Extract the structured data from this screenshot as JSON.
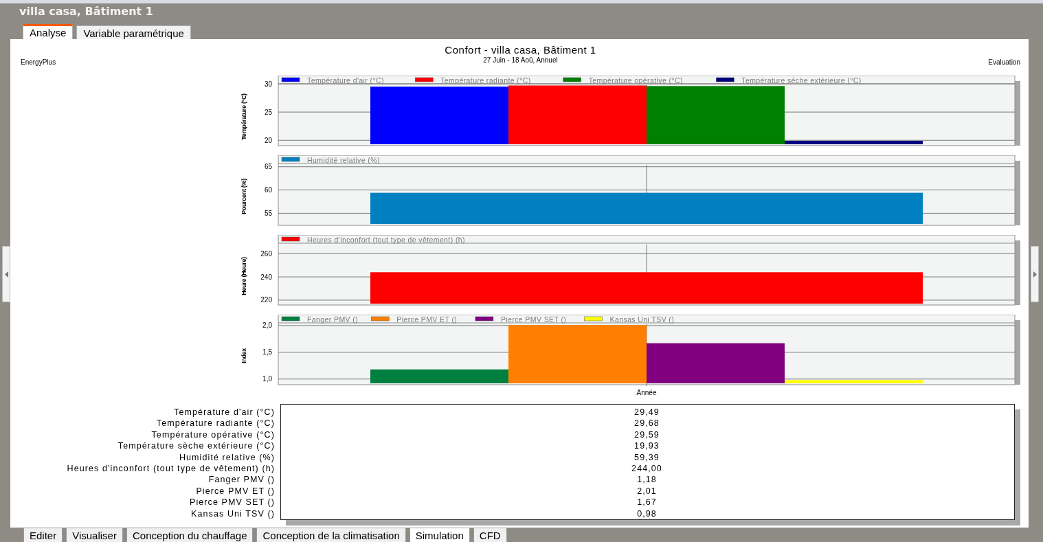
{
  "window": {
    "title": "villa casa, Bâtiment 1"
  },
  "tabs": [
    {
      "label": "Analyse",
      "selected": true
    },
    {
      "label": "Variable paramétrique",
      "selected": false
    }
  ],
  "report": {
    "source": "EnergyPlus",
    "title": "Confort - villa casa, Bâtiment 1",
    "subtitle": "27 Juin - 18 Aoû, Annuel",
    "mode": "Evaluation"
  },
  "charts": [
    {
      "chart_data": {
        "type": "bar",
        "grid": true,
        "legend": true,
        "ylabel": "Température (°C)",
        "ylim": [
          19.3,
          30
        ],
        "yticks": [
          {
            "value": 20,
            "label": "20"
          },
          {
            "value": 25,
            "label": "25"
          },
          {
            "value": 30,
            "label": "30"
          }
        ],
        "series": [
          {
            "name": "Température d'air (°C)",
            "color": "#0000ff",
            "values": [
              29.5
            ]
          },
          {
            "name": "Température radiante (°C)",
            "color": "#ff0000",
            "values": [
              29.7
            ]
          },
          {
            "name": "Température opérative (°C)",
            "color": "#008000",
            "values": [
              29.6
            ]
          },
          {
            "name": "Température sèche extérieure (°C)",
            "color": "#000080",
            "values": [
              19.9
            ]
          }
        ]
      }
    },
    {
      "chart_data": {
        "type": "bar",
        "grid": true,
        "legend": true,
        "ylabel": "Pourcent (%)",
        "ylim": [
          52.7,
          65.7
        ],
        "yticks": [
          {
            "value": 55,
            "label": "55"
          },
          {
            "value": 60,
            "label": "60"
          },
          {
            "value": 65,
            "label": "65"
          }
        ],
        "series": [
          {
            "name": "Humidité relative (%)",
            "color": "#0080c0",
            "values": [
              59.4
            ]
          }
        ]
      }
    },
    {
      "chart_data": {
        "type": "bar",
        "grid": true,
        "legend": true,
        "ylabel": "Heure (Heure)",
        "ylim": [
          217,
          269
        ],
        "yticks": [
          {
            "value": 220,
            "label": "220"
          },
          {
            "value": 240,
            "label": "240"
          },
          {
            "value": 260,
            "label": "260"
          }
        ],
        "series": [
          {
            "name": "Heures d'inconfort (tout type de vêtement) (h)",
            "color": "#ff0000",
            "values": [
              244.0
            ]
          }
        ]
      }
    },
    {
      "chart_data": {
        "type": "bar",
        "grid": true,
        "legend": true,
        "ylabel": "Index",
        "categories": [
          "Année"
        ],
        "ylim": [
          0.92,
          2.05
        ],
        "yticks": [
          {
            "value": 1,
            "label": "1,0"
          },
          {
            "value": 1.5,
            "label": "1,5"
          },
          {
            "value": 2,
            "label": "2,0"
          }
        ],
        "series": [
          {
            "name": "Fanger PMV ()",
            "color": "#008040",
            "values": [
              1.18
            ]
          },
          {
            "name": "Pierce PMV ET ()",
            "color": "#ff8000",
            "values": [
              2.01
            ]
          },
          {
            "name": "Pierce PMV SET ()",
            "color": "#800080",
            "values": [
              1.67
            ]
          },
          {
            "name": "Kansas Uni TSV ()",
            "color": "#ffff00",
            "values": [
              0.98
            ]
          }
        ]
      }
    }
  ],
  "summary": [
    {
      "label": "Température d'air (°C)",
      "value": "29,49"
    },
    {
      "label": "Température radiante (°C)",
      "value": "29,68"
    },
    {
      "label": "Température opérative (°C)",
      "value": "29,59"
    },
    {
      "label": "Température sèche extérieure (°C)",
      "value": "19,93"
    },
    {
      "label": "Humidité relative (%)",
      "value": "59,39"
    },
    {
      "label": "Heures d'inconfort (tout type de vêtement) (h)",
      "value": "244,00"
    },
    {
      "label": "Fanger PMV ()",
      "value": "1,18"
    },
    {
      "label": "Pierce PMV ET ()",
      "value": "2,01"
    },
    {
      "label": "Pierce PMV SET ()",
      "value": "1,67"
    },
    {
      "label": "Kansas Uni TSV ()",
      "value": "0,98"
    }
  ],
  "bottom_tabs": [
    {
      "label": "Editer",
      "selected": false
    },
    {
      "label": "Visualiser",
      "selected": false
    },
    {
      "label": "Conception du chauffage",
      "selected": false
    },
    {
      "label": "Conception de la climatisation",
      "selected": false
    },
    {
      "label": "Simulation",
      "selected": true
    },
    {
      "label": "CFD",
      "selected": false
    }
  ]
}
